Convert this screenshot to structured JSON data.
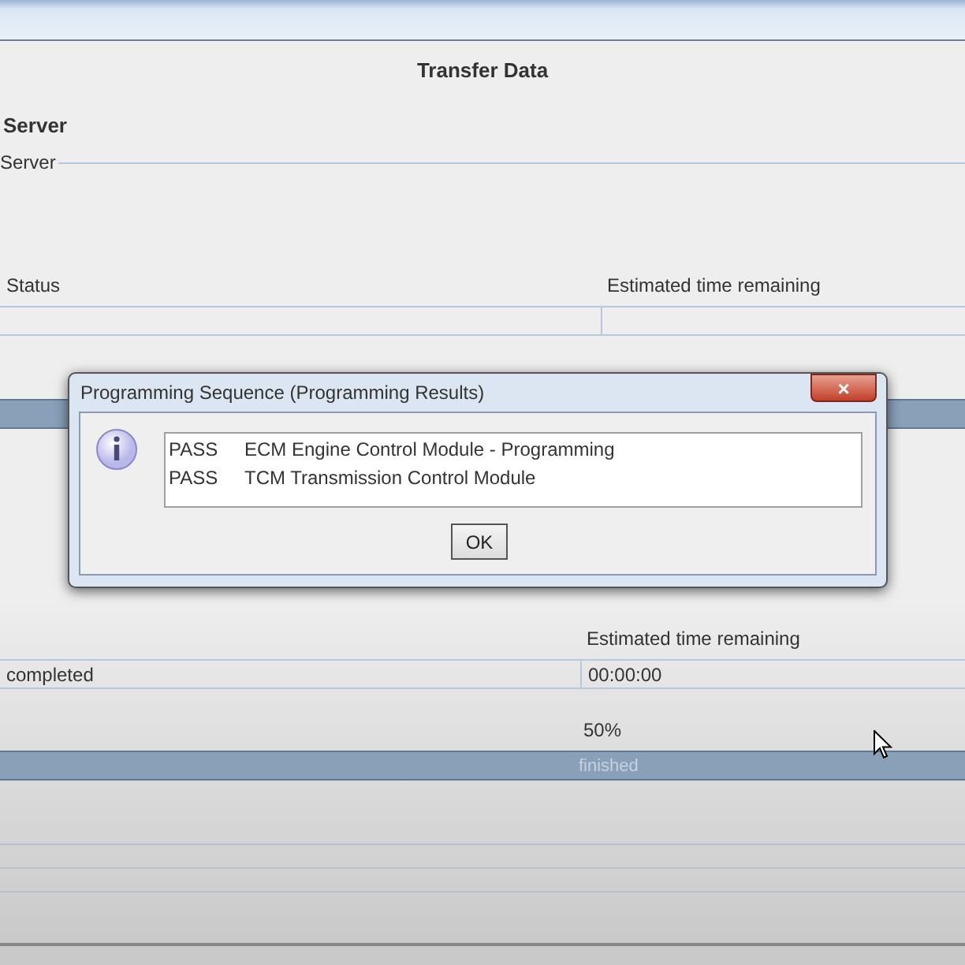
{
  "window": {
    "title": "Transfer Data"
  },
  "server_heading": "Server",
  "server_group": {
    "label": "Server"
  },
  "status_table": {
    "columns": [
      "Status",
      "Estimated time remaining"
    ],
    "rows": [
      [
        "",
        ""
      ]
    ]
  },
  "upper_progress": {
    "level": 1
  },
  "result_table": {
    "columns": [
      "",
      "Estimated time remaining"
    ],
    "rows": [
      [
        "completed",
        "00:00:00"
      ]
    ]
  },
  "progress": {
    "percent": "50%",
    "level": 1,
    "text": "finished"
  },
  "dialog": {
    "title": "Programming Sequence (Programming Results)",
    "close": "×",
    "results": [
      {
        "status": "PASS",
        "module": "ECM Engine Control Module - Programming"
      },
      {
        "status": "PASS",
        "module": "TCM Transmission Control Module"
      }
    ],
    "buttons": [
      "OK"
    ]
  }
}
